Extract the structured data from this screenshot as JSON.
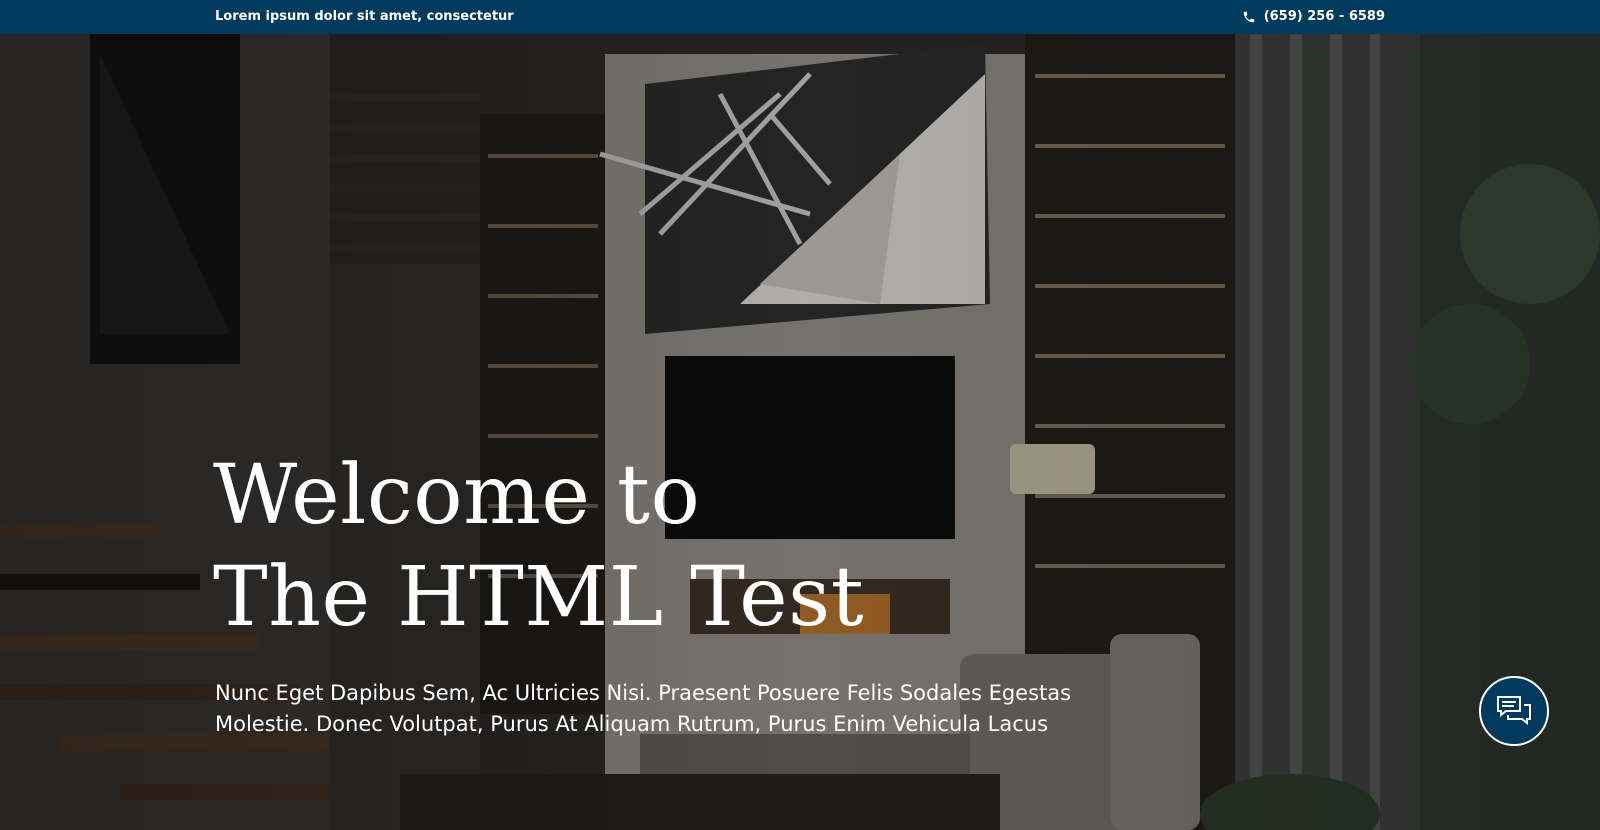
{
  "topbar": {
    "tagline": "Lorem ipsum dolor sit amet, consectetur",
    "phone_icon": "phone-icon",
    "phone": "(659) 256 - 6589"
  },
  "hero": {
    "heading_line1": "Welcome to",
    "heading_line2": "The HTML Test",
    "subtext": "Nunc Eget Dapibus Sem, Ac Ultricies Nisi. Praesent Posuere Felis Sodales Egestas Molestie. Donec Volutpat, Purus At Aliquam Rutrum, Purus Enim Vehicula Lacus"
  },
  "chat_button": {
    "icon": "chat-bubbles-icon"
  },
  "colors": {
    "topbar_bg": "#003a5d",
    "chat_bg": "#003a5d",
    "text": "#ffffff"
  }
}
